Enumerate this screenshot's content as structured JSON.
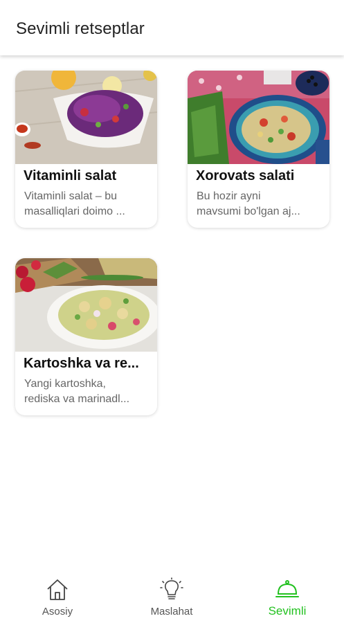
{
  "header": {
    "title": "Sevimli retseptlar"
  },
  "recipes": [
    {
      "title": "Vitaminli salat",
      "desc_line1": "Vitaminli salat – bu",
      "desc_line2": "masalliqlari doimo ...",
      "image_icon": "red-cabbage-salad-photo"
    },
    {
      "title": "Xorovats salati",
      "desc_line1": "Bu hozir ayni",
      "desc_line2": "mavsumi bo'lgan aj...",
      "image_icon": "xorovats-salad-photo"
    },
    {
      "title": "Kartoshka va re...",
      "desc_line1": "Yangi kartoshka,",
      "desc_line2": "rediska va marinadl...",
      "image_icon": "potato-radish-salad-photo"
    }
  ],
  "nav": {
    "home_label": "Asosiy",
    "tips_label": "Maslahat",
    "fav_label": "Sevimli",
    "active_color": "#22c11f",
    "inactive_color": "#555555",
    "icons": {
      "home": "home-icon",
      "tips": "lightbulb-icon",
      "fav": "cloche-icon"
    }
  }
}
